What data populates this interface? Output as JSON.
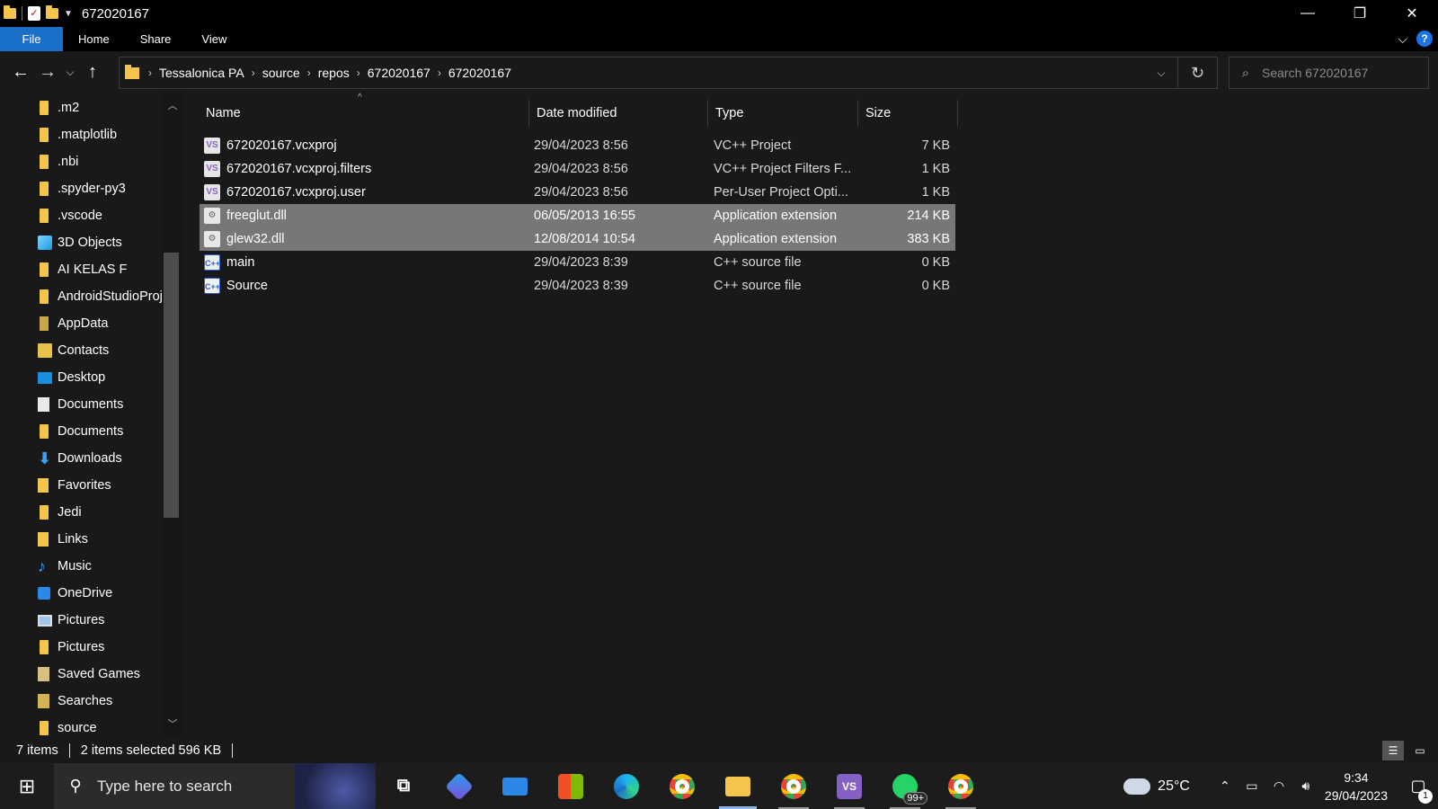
{
  "window": {
    "title": "672020167",
    "minimize_label": "—",
    "restore_label": "❐",
    "close_label": "✕"
  },
  "ribbon": {
    "tabs": [
      "File",
      "Home",
      "Share",
      "View"
    ],
    "help_label": "?",
    "expand_label": "⌵"
  },
  "nav": {
    "back_label": "←",
    "forward_label": "→",
    "recent_label": "⌵",
    "up_label": "↑"
  },
  "breadcrumb": [
    "Tessalonica PA",
    "source",
    "repos",
    "672020167",
    "672020167"
  ],
  "search": {
    "placeholder": "Search 672020167"
  },
  "sidebar": {
    "items": [
      {
        "label": ".m2",
        "icon": "folder-icon"
      },
      {
        "label": ".matplotlib",
        "icon": "folder-icon"
      },
      {
        "label": ".nbi",
        "icon": "folder-icon"
      },
      {
        "label": ".spyder-py3",
        "icon": "folder-icon"
      },
      {
        "label": ".vscode",
        "icon": "folder-icon"
      },
      {
        "label": "3D Objects",
        "icon": "3d-objects-icon"
      },
      {
        "label": "AI KELAS F",
        "icon": "folder-icon"
      },
      {
        "label": "AndroidStudioProjects",
        "icon": "folder-icon"
      },
      {
        "label": "AppData",
        "icon": "folder-icon"
      },
      {
        "label": "Contacts",
        "icon": "contacts-icon"
      },
      {
        "label": "Desktop",
        "icon": "desktop-icon"
      },
      {
        "label": "Documents",
        "icon": "documents-icon"
      },
      {
        "label": "Documents",
        "icon": "folder-icon"
      },
      {
        "label": "Downloads",
        "icon": "downloads-icon"
      },
      {
        "label": "Favorites",
        "icon": "favorites-icon"
      },
      {
        "label": "Jedi",
        "icon": "folder-icon"
      },
      {
        "label": "Links",
        "icon": "links-icon"
      },
      {
        "label": "Music",
        "icon": "music-icon"
      },
      {
        "label": "OneDrive",
        "icon": "onedrive-icon"
      },
      {
        "label": "Pictures",
        "icon": "pictures-icon"
      },
      {
        "label": "Pictures",
        "icon": "folder-icon"
      },
      {
        "label": "Saved Games",
        "icon": "saved-games-icon"
      },
      {
        "label": "Searches",
        "icon": "searches-icon"
      },
      {
        "label": "source",
        "icon": "folder-icon"
      }
    ]
  },
  "columns": {
    "name": "Name",
    "date": "Date modified",
    "type": "Type",
    "size": "Size"
  },
  "files": [
    {
      "name": "672020167.vcxproj",
      "date": "29/04/2023 8:56",
      "type": "VC++ Project",
      "size": "7 KB",
      "icon": "vcxproj-icon",
      "glyph": "VS",
      "selected": false
    },
    {
      "name": "672020167.vcxproj.filters",
      "date": "29/04/2023 8:56",
      "type": "VC++ Project Filters F...",
      "size": "1 KB",
      "icon": "vcxproj-filters-icon",
      "glyph": "VS",
      "selected": false
    },
    {
      "name": "672020167.vcxproj.user",
      "date": "29/04/2023 8:56",
      "type": "Per-User Project Opti...",
      "size": "1 KB",
      "icon": "vcxproj-user-icon",
      "glyph": "VS",
      "selected": false
    },
    {
      "name": "freeglut.dll",
      "date": "06/05/2013 16:55",
      "type": "Application extension",
      "size": "214 KB",
      "icon": "dll-icon",
      "glyph": "⚙",
      "selected": true
    },
    {
      "name": "glew32.dll",
      "date": "12/08/2014 10:54",
      "type": "Application extension",
      "size": "383 KB",
      "icon": "dll-icon",
      "glyph": "⚙",
      "selected": true
    },
    {
      "name": "main",
      "date": "29/04/2023 8:39",
      "type": "C++ source file",
      "size": "0 KB",
      "icon": "cpp-file-icon",
      "glyph": "C++",
      "selected": false
    },
    {
      "name": "Source",
      "date": "29/04/2023 8:39",
      "type": "C++ source file",
      "size": "0 KB",
      "icon": "cpp-file-icon",
      "glyph": "C++",
      "selected": false
    }
  ],
  "status": {
    "items_count": "7 items",
    "selection": "2 items selected  596 KB"
  },
  "taskbar": {
    "search_placeholder": "Type here to search",
    "whatsapp_badge": "99+",
    "weather": "25°C",
    "time": "9:34",
    "date": "29/04/2023",
    "notification_count": "1"
  }
}
